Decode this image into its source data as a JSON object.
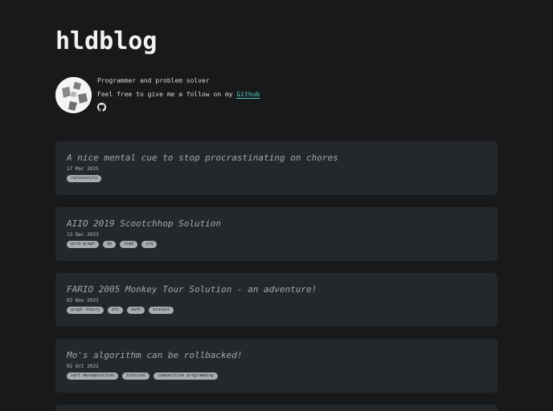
{
  "site": {
    "title": "hldblog"
  },
  "profile": {
    "tagline": "Programmer and problem solver",
    "follow_text": "Feel free to give me a follow on my ",
    "github_link": "Github",
    "icons": [
      "avatar",
      "github-icon"
    ]
  },
  "colors": {
    "background": "#18191b",
    "card": "#25282b",
    "link": "#4fd1c5",
    "tag_bg": "#a9acb0"
  },
  "posts": [
    {
      "title": "A nice mental cue to stop procrastinating on chores",
      "date": "17 Mar 2025",
      "tags": [
        "rationality"
      ]
    },
    {
      "title": "AIIO 2019 Scootchhop Solution",
      "date": "13 Dec 2023",
      "tags": [
        "grid graph",
        "dp",
        "simd",
        "srq"
      ]
    },
    {
      "title": "FARIO 2005 Monkey Tour Solution - an adventure!",
      "date": "02 Nov 2022",
      "tags": [
        "graph theory",
        "bfs",
        "math",
        "kruskal"
      ]
    },
    {
      "title": "Mo's algorithm can be rollbacked!",
      "date": "02 Oct 2022",
      "tags": [
        "sqrt decomposition",
        "tutorial",
        "competitive programming"
      ]
    }
  ]
}
